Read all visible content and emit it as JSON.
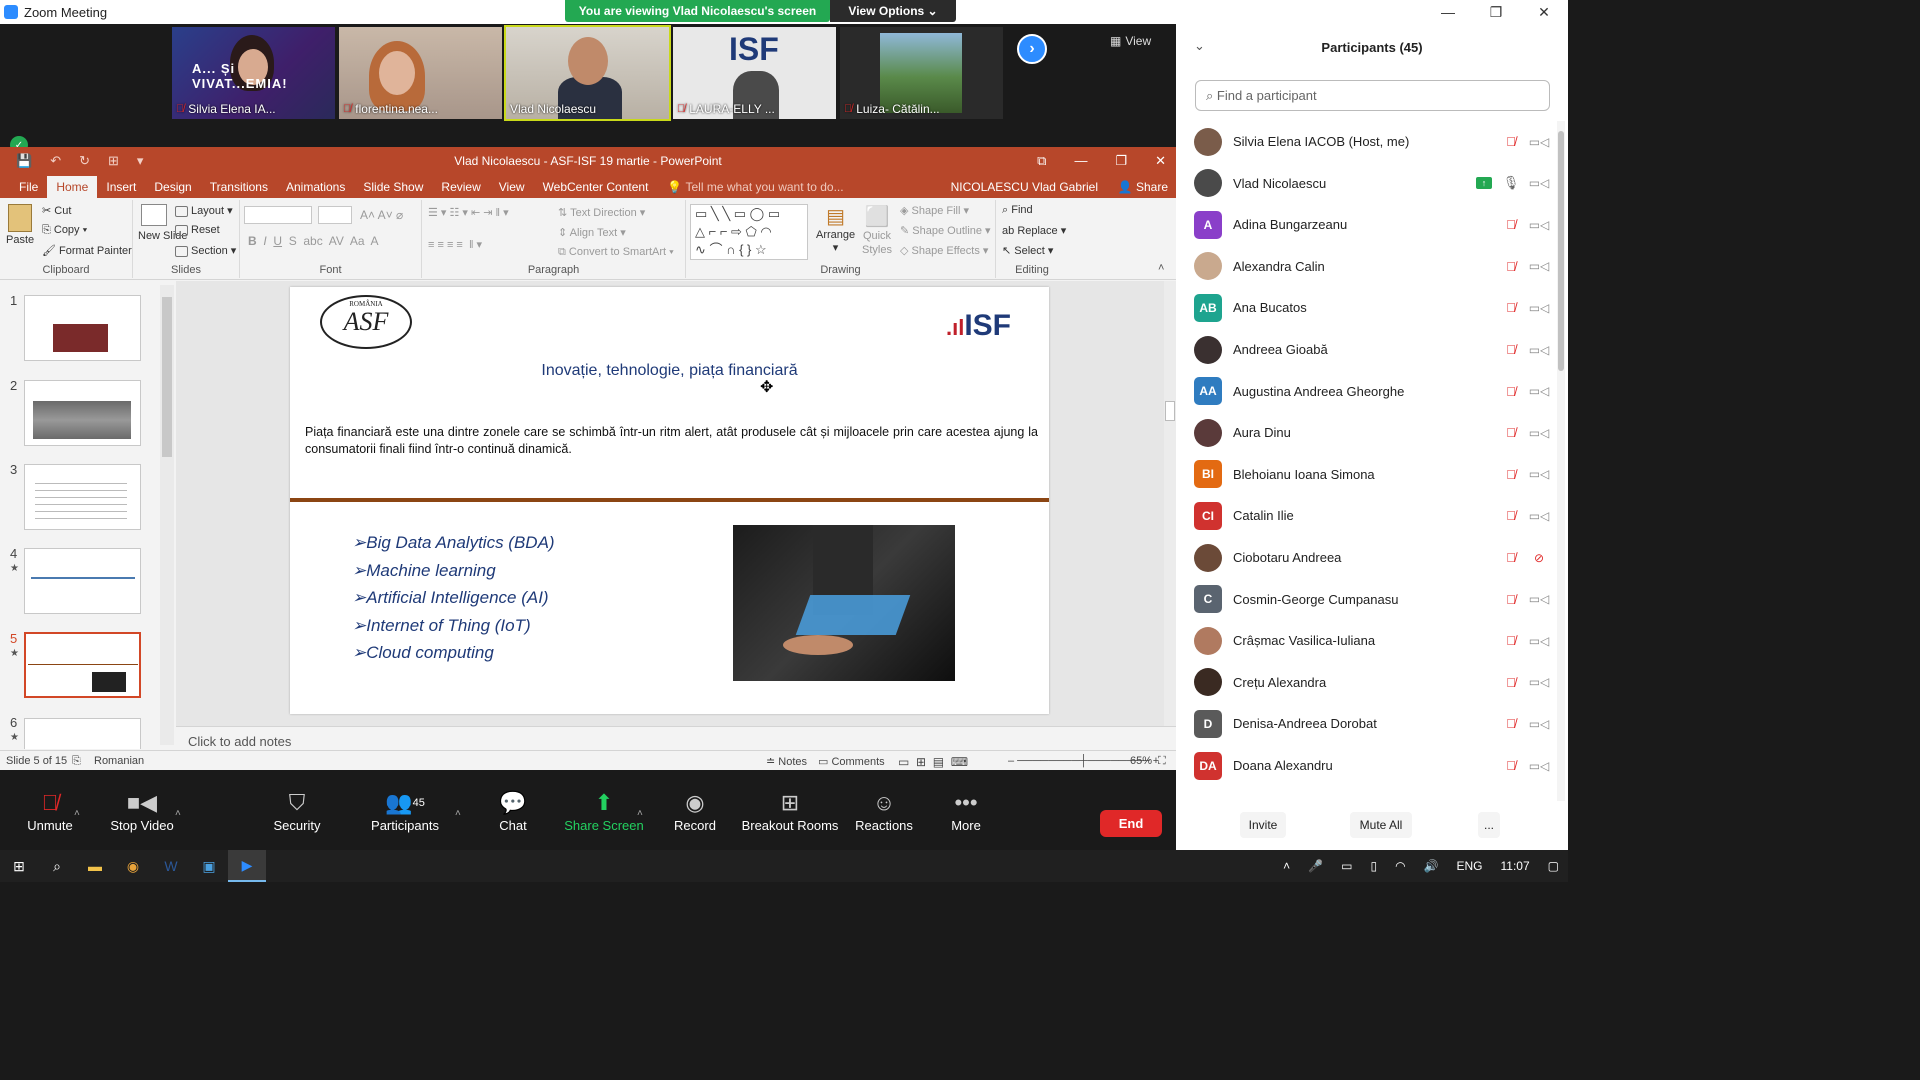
{
  "window": {
    "title": "Zoom Meeting",
    "controls": [
      "—",
      "❐",
      "✕"
    ]
  },
  "banner": {
    "viewing": "You are viewing Vlad Nicolaescu's screen",
    "view_options": "View Options"
  },
  "strip": {
    "view_label": "View",
    "tiles": [
      {
        "name": "Silvia Elena IA...",
        "muted": true
      },
      {
        "name": "florentina.nea...",
        "muted": true
      },
      {
        "name": "Vlad Nicolaescu",
        "muted": false
      },
      {
        "name": "LAURA-ELLY ...",
        "muted": true
      },
      {
        "name": "Luiza- Cătălin...",
        "muted": true
      }
    ],
    "tile1_caption": "A... Și VIVAT...EMIA!",
    "tile4_logo": "ISF"
  },
  "ppt": {
    "doc_title": "Vlad Nicolaescu - ASF-ISF 19 martie - PowerPoint",
    "tabs": [
      "File",
      "Home",
      "Insert",
      "Design",
      "Transitions",
      "Animations",
      "Slide Show",
      "Review",
      "View",
      "WebCenter Content"
    ],
    "active_tab": "Home",
    "tell_me": "Tell me what you want to do...",
    "user": "NICOLAESCU Vlad Gabriel",
    "share": "Share",
    "ribbon": {
      "clipboard": {
        "label": "Clipboard",
        "paste": "Paste",
        "cut": "Cut",
        "copy": "Copy",
        "format_painter": "Format Painter"
      },
      "slides": {
        "label": "Slides",
        "new_slide": "New Slide",
        "layout": "Layout",
        "reset": "Reset",
        "section": "Section"
      },
      "font": {
        "label": "Font"
      },
      "paragraph": {
        "label": "Paragraph",
        "text_direction": "Text Direction",
        "align_text": "Align Text",
        "convert": "Convert to SmartArt"
      },
      "drawing": {
        "label": "Drawing",
        "arrange": "Arrange",
        "quick_styles": "Quick Styles",
        "shape_fill": "Shape Fill",
        "shape_outline": "Shape Outline",
        "shape_effects": "Shape Effects"
      },
      "editing": {
        "label": "Editing",
        "find": "Find",
        "replace": "Replace",
        "select": "Select"
      }
    },
    "thumbs": [
      {
        "num": "1",
        "star": false
      },
      {
        "num": "2",
        "star": false
      },
      {
        "num": "3",
        "star": false
      },
      {
        "num": "4",
        "star": true
      },
      {
        "num": "5",
        "star": true
      },
      {
        "num": "6",
        "star": true
      }
    ],
    "selected_slide": 5,
    "slide": {
      "seal_text": "ASF",
      "seal_top": "ROMÂNIA",
      "logo": "ISF",
      "title": "Inovație, tehnologie, piața financiară",
      "body": "Piața financiară este una dintre zonele care se schimbă într-un ritm alert, atât produsele cât și mijloacele prin care acestea ajung la consumatorii finali fiind într-o continuă dinamică.",
      "bullets": [
        "Big Data Analytics (BDA)",
        "Machine learning",
        "Artificial Intelligence (AI)",
        "Internet of Thing (IoT)",
        "Cloud computing"
      ]
    },
    "notes_placeholder": "Click to add notes",
    "status": {
      "slide": "Slide 5 of 15",
      "language": "Romanian",
      "notes": "Notes",
      "comments": "Comments",
      "zoom": "65%"
    }
  },
  "toolbar": {
    "unmute": "Unmute",
    "stop_video": "Stop Video",
    "security": "Security",
    "participants": "Participants",
    "participants_count": "45",
    "chat": "Chat",
    "share_screen": "Share Screen",
    "record": "Record",
    "breakout": "Breakout Rooms",
    "reactions": "Reactions",
    "more": "More",
    "end": "End"
  },
  "panel": {
    "title": "Participants (45)",
    "search_placeholder": "Find a participant",
    "participants": [
      {
        "name": "Silvia Elena IACOB (Host, me)",
        "initials": "",
        "color": "#7a5c4a",
        "photo": true,
        "mic": "off",
        "cam": "on",
        "sharing": false
      },
      {
        "name": "Vlad Nicolaescu",
        "initials": "",
        "color": "#4a4a4a",
        "photo": true,
        "mic": "on",
        "cam": "on",
        "sharing": true
      },
      {
        "name": "Adina Bungarzeanu",
        "initials": "A",
        "color": "#8a3fc9",
        "photo": false,
        "mic": "off",
        "cam": "on",
        "sharing": false
      },
      {
        "name": "Alexandra Calin",
        "initials": "",
        "color": "#c9a98e",
        "photo": true,
        "mic": "off",
        "cam": "on",
        "sharing": false
      },
      {
        "name": "Ana Bucatos",
        "initials": "AB",
        "color": "#1ea48f",
        "photo": false,
        "mic": "off",
        "cam": "on",
        "sharing": false
      },
      {
        "name": "Andreea Gioabă",
        "initials": "",
        "color": "#3a3030",
        "photo": true,
        "mic": "off",
        "cam": "on",
        "sharing": false
      },
      {
        "name": "Augustina Andreea Gheorghe",
        "initials": "AA",
        "color": "#2f7cc0",
        "photo": false,
        "mic": "off",
        "cam": "on",
        "sharing": false
      },
      {
        "name": "Aura Dinu",
        "initials": "",
        "color": "#5a3a3a",
        "photo": true,
        "mic": "off",
        "cam": "on",
        "sharing": false
      },
      {
        "name": "Blehoianu Ioana Simona",
        "initials": "BI",
        "color": "#e36a12",
        "photo": false,
        "mic": "off",
        "cam": "on",
        "sharing": false
      },
      {
        "name": "Catalin Ilie",
        "initials": "CI",
        "color": "#d0322f",
        "photo": false,
        "mic": "off",
        "cam": "on",
        "sharing": false
      },
      {
        "name": "Ciobotaru Andreea",
        "initials": "",
        "color": "#6b4a38",
        "photo": true,
        "mic": "off",
        "cam": "off",
        "sharing": false
      },
      {
        "name": "Cosmin-George Cumpanasu",
        "initials": "C",
        "color": "#5a6470",
        "photo": false,
        "mic": "off",
        "cam": "on",
        "sharing": false
      },
      {
        "name": "Crâșmac Vasilica-Iuliana",
        "initials": "",
        "color": "#b07a60",
        "photo": true,
        "mic": "off",
        "cam": "on",
        "sharing": false
      },
      {
        "name": "Crețu Alexandra",
        "initials": "",
        "color": "#3a2a22",
        "photo": true,
        "mic": "off",
        "cam": "on",
        "sharing": false
      },
      {
        "name": "Denisa-Andreea Dorobat",
        "initials": "D",
        "color": "#5a5a5a",
        "photo": false,
        "mic": "off",
        "cam": "on",
        "sharing": false
      },
      {
        "name": "Doana Alexandru",
        "initials": "DA",
        "color": "#d0322f",
        "photo": false,
        "mic": "off",
        "cam": "on",
        "sharing": false
      }
    ],
    "invite": "Invite",
    "mute_all": "Mute All",
    "more": "..."
  },
  "taskbar": {
    "lang": "ENG",
    "time": "11:07"
  }
}
